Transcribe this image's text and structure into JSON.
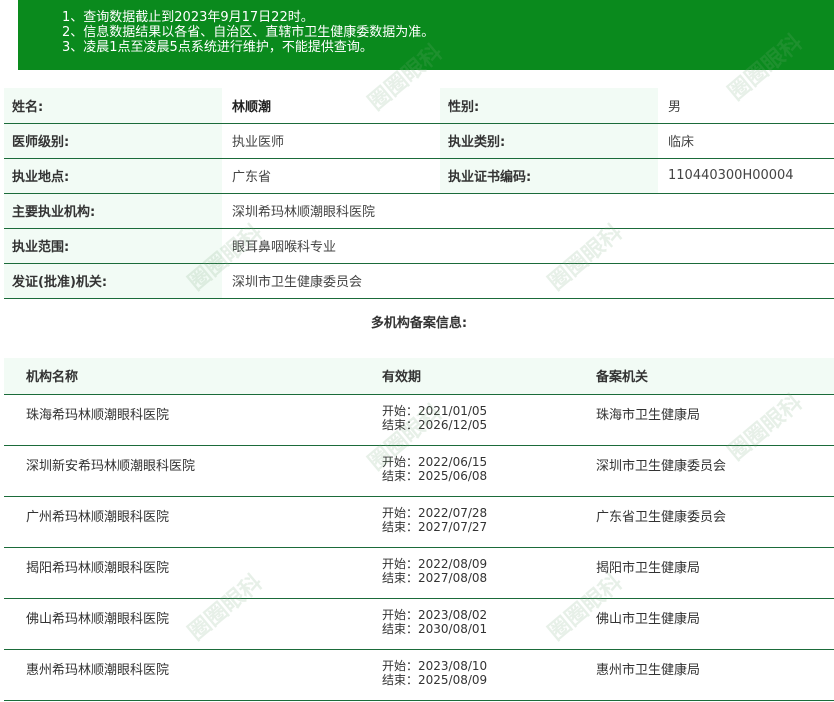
{
  "notice": {
    "lines": [
      "1、查询数据截止到2023年9月17日22时。",
      "2、信息数据结果以各省、自治区、直辖市卫生健康委数据为准。",
      "3、凌晨1点至凌晨5点系统进行维护，不能提供查询。"
    ]
  },
  "info": {
    "name_label": "姓名:",
    "name_value": "林顺潮",
    "gender_label": "性别:",
    "gender_value": "男",
    "level_label": "医师级别:",
    "level_value": "执业医师",
    "category_label": "执业类别:",
    "category_value": "临床",
    "location_label": "执业地点:",
    "location_value": "广东省",
    "cert_label": "执业证书编码:",
    "cert_value": "110440300H00004",
    "org_label": "主要执业机构:",
    "org_value": "深圳希玛林顺潮眼科医院",
    "scope_label": "执业范围:",
    "scope_value": "眼耳鼻咽喉科专业",
    "issuer_label": "发证(批准)机关:",
    "issuer_value": "深圳市卫生健康委员会"
  },
  "multi": {
    "title": "多机构备案信息:",
    "headers": {
      "name": "机构名称",
      "validity": "有效期",
      "authority": "备案机关"
    },
    "rows": [
      {
        "name": "珠海希玛林顺潮眼科医院",
        "start": "开始：2021/01/05",
        "end": "结束：2026/12/05",
        "authority": "珠海市卫生健康局"
      },
      {
        "name": "深圳新安希玛林顺潮眼科医院",
        "start": "开始：2022/06/15",
        "end": "结束：2025/06/08",
        "authority": "深圳市卫生健康委员会"
      },
      {
        "name": "广州希玛林顺潮眼科医院",
        "start": "开始：2022/07/28",
        "end": "结束：2027/07/27",
        "authority": "广东省卫生健康委员会"
      },
      {
        "name": "揭阳希玛林顺潮眼科医院",
        "start": "开始：2022/08/09",
        "end": "结束：2027/08/08",
        "authority": "揭阳市卫生健康局"
      },
      {
        "name": "佛山希玛林顺潮眼科医院",
        "start": "开始：2023/08/02",
        "end": "结束：2030/08/01",
        "authority": "佛山市卫生健康局"
      },
      {
        "name": "惠州希玛林顺潮眼科医院",
        "start": "开始：2023/08/10",
        "end": "结束：2025/08/09",
        "authority": "惠州市卫生健康局"
      }
    ]
  },
  "watermark": "圈圈眼科"
}
